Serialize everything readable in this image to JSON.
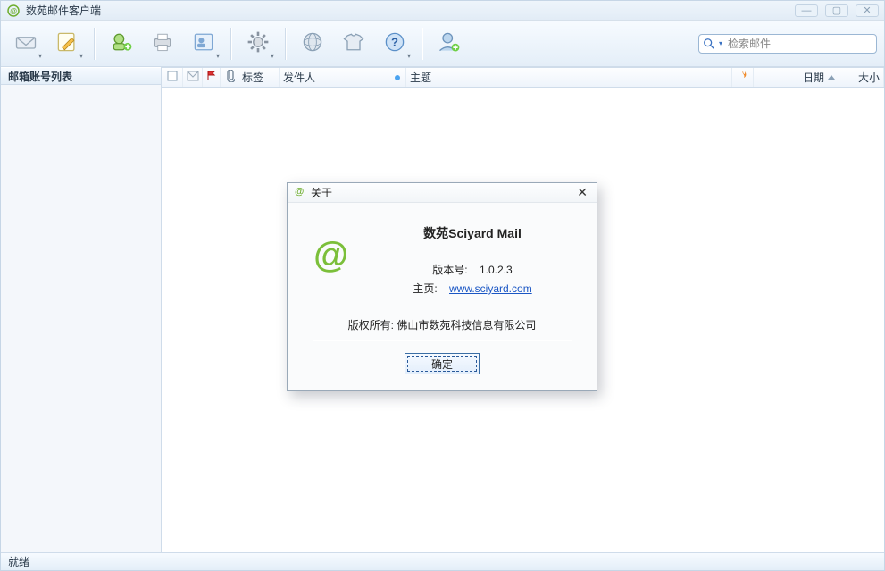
{
  "app": {
    "title": "数苑邮件客户端"
  },
  "search": {
    "placeholder": "检索邮件"
  },
  "sidebar": {
    "header": "邮箱账号列表"
  },
  "toolbar": {
    "icons": {
      "fetch": "mail-receive-icon",
      "compose": "compose-icon",
      "add_account": "add-account-icon",
      "print": "print-icon",
      "contacts": "contacts-icon",
      "settings": "gear-icon",
      "web": "globe-icon",
      "apparel": "tshirt-icon",
      "help": "help-icon",
      "user": "user-add-icon"
    }
  },
  "columns": {
    "check": "",
    "envelope": "",
    "flag": "",
    "attach": "",
    "label": "标签",
    "sender": "发件人",
    "dot": "",
    "subject": "主题",
    "fire": "",
    "date": "日期",
    "size": "大小"
  },
  "status": {
    "text": "就绪"
  },
  "about": {
    "title": "关于",
    "product": "数苑Sciyard Mail",
    "version_label": "版本号:",
    "version_value": "1.0.2.3",
    "homepage_label": "主页:",
    "homepage_value": "www.sciyard.com",
    "copyright": "版权所有:  佛山市数苑科技信息有限公司",
    "ok": "确定"
  }
}
